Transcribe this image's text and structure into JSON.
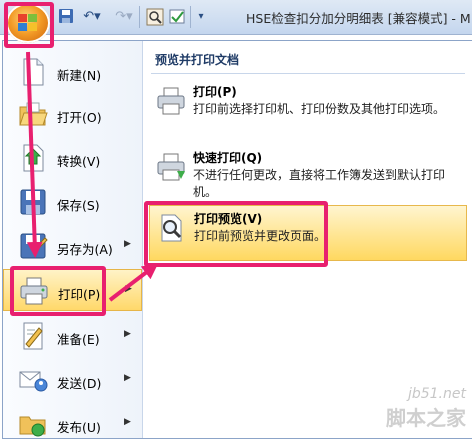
{
  "window": {
    "title": "HSE检查扣分加分明细表  [兼容模式] - M"
  },
  "quick_access": {
    "icons": [
      "save-icon",
      "undo-icon",
      "redo-icon",
      "print-preview-icon",
      "spelling-icon",
      "customize-dropdown-icon"
    ]
  },
  "left_menu": {
    "items": [
      {
        "label": "新建(N)",
        "icon": "new-document-icon",
        "has_submenu": false
      },
      {
        "label": "打开(O)",
        "icon": "open-folder-icon",
        "has_submenu": false
      },
      {
        "label": "转换(V)",
        "icon": "convert-icon",
        "has_submenu": false
      },
      {
        "label": "保存(S)",
        "icon": "save-icon",
        "has_submenu": false
      },
      {
        "label": "另存为(A)",
        "icon": "save-as-icon",
        "has_submenu": true
      },
      {
        "label": "打印(P)",
        "icon": "printer-icon",
        "has_submenu": true
      },
      {
        "label": "准备(E)",
        "icon": "prepare-icon",
        "has_submenu": true
      },
      {
        "label": "发送(D)",
        "icon": "send-icon",
        "has_submenu": true
      },
      {
        "label": "发布(U)",
        "icon": "publish-icon",
        "has_submenu": true
      }
    ],
    "active_index": 5
  },
  "print_panel": {
    "header": "预览并打印文档",
    "items": [
      {
        "title": "打印(P)",
        "desc": "打印前选择打印机、打印份数及其他打印选项。",
        "icon": "printer-icon"
      },
      {
        "title": "快速打印(Q)",
        "desc": "不进行任何更改，直接将工作簿发送到默认打印机。",
        "icon": "quick-print-icon"
      },
      {
        "title": "打印预览(V)",
        "desc": "打印前预览并更改页面。",
        "icon": "print-preview-icon"
      }
    ],
    "active_index": 2
  },
  "watermark": {
    "url": "jb51.net",
    "name": "脚本之家"
  },
  "colors": {
    "highlight": "#e8206f",
    "hover_fill": "#ffd860"
  }
}
